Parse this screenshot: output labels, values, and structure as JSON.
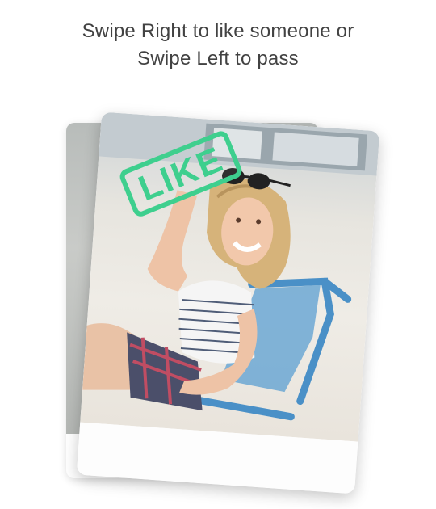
{
  "instruction": {
    "line1": "Swipe Right to like someone or",
    "line2": "Swipe Left to pass"
  },
  "card": {
    "stamp_label": "LIKE"
  },
  "colors": {
    "stamp": "#3ecf8e",
    "text": "#424242",
    "chair": "#4a90c7"
  }
}
